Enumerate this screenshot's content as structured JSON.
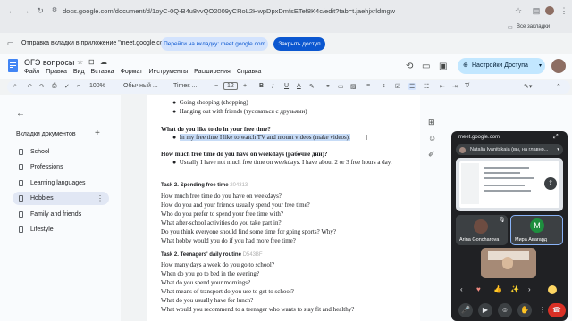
{
  "browser": {
    "url": "docs.google.com/document/d/1oyC-0Q-B4u8vvQO2009yCRoL2HwpDpxDmfsETef8K4c/edit?tab=t.jaehjxrldmgw",
    "bookmarks_label": "Все закладки"
  },
  "banner": {
    "message": "Отправка вкладки в приложение \"meet.google.com\".",
    "switch_label": "Перейти на вкладку: meet.google.com",
    "share_label": "Закрыть доступ"
  },
  "doc": {
    "title": "ОГЭ вопросы",
    "menu": [
      "Файл",
      "Правка",
      "Вид",
      "Вставка",
      "Формат",
      "Инструменты",
      "Расширения",
      "Справка"
    ],
    "share_button": "Настройки Доступа"
  },
  "toolbar": {
    "zoom": "100%",
    "style": "Обычный ...",
    "font": "Times ...",
    "size": "12"
  },
  "sidebar": {
    "title": "Вкладки документов",
    "tabs": [
      "School",
      "Professions",
      "Learning languages",
      "Hobbies",
      "Family and friends",
      "Lifestyle"
    ],
    "active_index": 3
  },
  "content": {
    "bullets_top": [
      "Going shopping (shopping)",
      "Hanging out with friends (тусоваться с друзьями)"
    ],
    "q1": "What do you like to do in your free time?",
    "a1": "In my free time I like to watch TV and mount videos (make videos).",
    "q2": "How much free time do you have on weekdays (рабочие дни)?",
    "a2": "Usually I have not much free time on weekdays. I have about 2 or 3 free hours a day.",
    "task2_title": "Task 2. Spending free time",
    "task2_code": "204313",
    "task2_lines": [
      "How much free time do you have on weekdays?",
      "How do you and your friends usually spend your free time?",
      "Who do you prefer to spend your free time with?",
      "What after-school activities do you take part in?",
      "Do you think everyone should find some time for going sports? Why?",
      "What hobby would you do if you had more free time?"
    ],
    "task3_title": "Task 2. Teenagers' daily routine",
    "task3_code": "D543BF",
    "task3_lines": [
      "How many days a week do you go to school?",
      "When do you go to bed in the evening?",
      "What do you spend your mornings?",
      "What means of transport do you use to get to school?",
      "What do you usually have for lunch?",
      "What would you recommend to a teenager who wants to stay fit and healthy?"
    ]
  },
  "meet": {
    "host": "meet.google.com",
    "presenter": "Natalia Ivanitskaia (вы, на главно...",
    "participants": [
      {
        "name": "Arina Goncharova",
        "color": "#3c4043"
      },
      {
        "name": "Мира Авагард",
        "initial": "M",
        "color": "#1e8e3e"
      }
    ]
  },
  "colors": {
    "accent": "#0b57d0",
    "pill": "#d3e3fd",
    "active_tab": "#e1e7f4",
    "end_call": "#d93025"
  }
}
